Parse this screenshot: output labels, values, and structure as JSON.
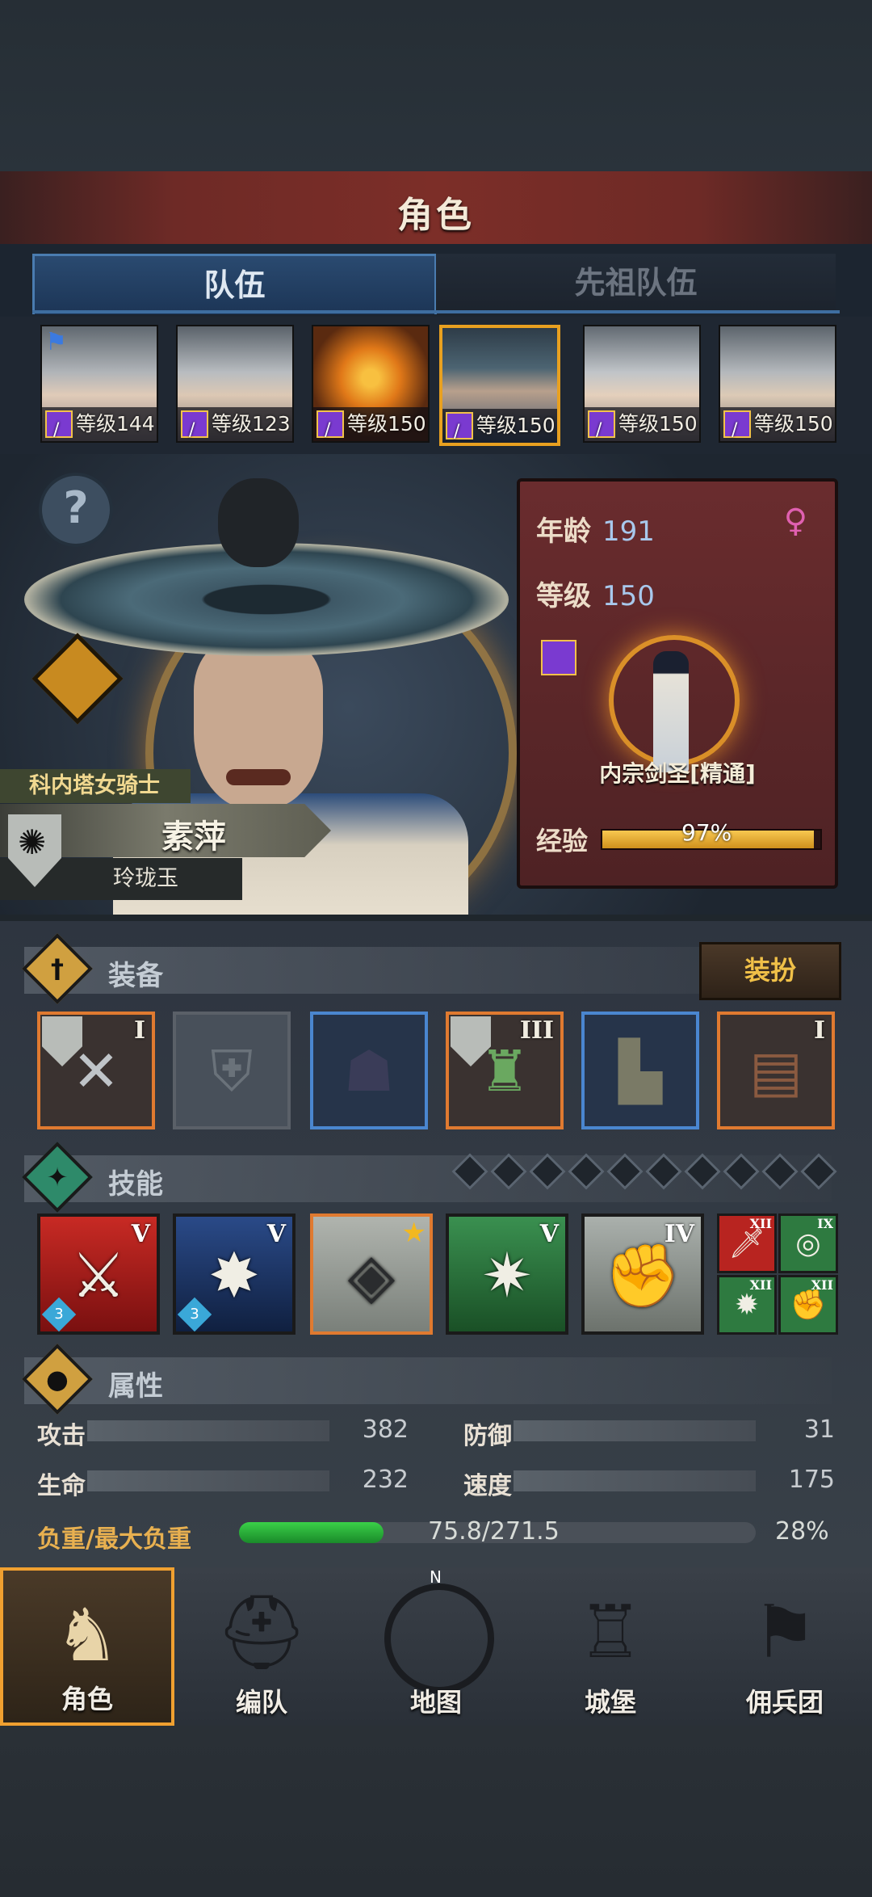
{
  "header": {
    "title": "角色"
  },
  "tabs": [
    {
      "label": "队伍",
      "active": true
    },
    {
      "label": "先祖队伍",
      "active": false
    }
  ],
  "roster": [
    {
      "level_text": "等级144",
      "portrait": "elf-woman-portrait",
      "flag": true
    },
    {
      "level_text": "等级123",
      "portrait": "elf-woman-portrait"
    },
    {
      "level_text": "等级150",
      "portrait": "pumpkin-portrait"
    },
    {
      "level_text": "等级150",
      "portrait": "straw-hat-swordsman-portrait",
      "selected": true
    },
    {
      "level_text": "等级150",
      "portrait": "elf-woman-portrait"
    },
    {
      "level_text": "等级150",
      "portrait": "elf-woman-portrait"
    }
  ],
  "character": {
    "faction": "科内塔女骑士",
    "name": "素萍",
    "title": "玲珑玉",
    "age_label": "年龄",
    "age": "191",
    "gender_icon": "female-icon",
    "level_label": "等级",
    "level": "150",
    "class_name": "内宗剑圣[精通]",
    "exp_label": "经验",
    "exp_text": "97%",
    "exp_fraction": 0.97
  },
  "equipment": {
    "section_title": "装备",
    "outfit_button": "装扮",
    "slots": [
      {
        "item": "crossed-blades-icon",
        "rank": "I",
        "rarity": "orange",
        "badge": true
      },
      {
        "item": "empty-shield-slot-icon",
        "rank": "",
        "rarity": "empty"
      },
      {
        "item": "hood-icon",
        "rank": "",
        "rarity": "blue"
      },
      {
        "item": "green-armor-icon",
        "rank": "III",
        "rarity": "orange",
        "badge": true
      },
      {
        "item": "boots-icon",
        "rank": "",
        "rarity": "blue"
      },
      {
        "item": "tome-icon",
        "rank": "I",
        "rarity": "orange"
      }
    ]
  },
  "skills": {
    "section_title": "技能",
    "pip_count": 10,
    "items": [
      {
        "icon": "broken-sword-icon",
        "rank": "V",
        "gem": "3",
        "color": "red"
      },
      {
        "icon": "summon-burst-icon",
        "rank": "V",
        "gem": "3",
        "color": "navy"
      },
      {
        "icon": "crystal-sword-icon",
        "rank": "",
        "star": true,
        "color": "grey"
      },
      {
        "icon": "crystal-blast-icon",
        "rank": "V",
        "color": "green"
      },
      {
        "icon": "crystal-fist-icon",
        "rank": "IV",
        "color": "greyb"
      }
    ],
    "mini": [
      {
        "icon": "sword-icon",
        "rank": "XII",
        "color": "#b82420"
      },
      {
        "icon": "target-icon",
        "rank": "IX",
        "color": "#2e7a40"
      },
      {
        "icon": "burst-icon",
        "rank": "XII",
        "color": "#2e7a40"
      },
      {
        "icon": "fist-icon",
        "rank": "XII",
        "color": "#2e7a40"
      }
    ]
  },
  "attributes": {
    "section_title": "属性",
    "attack_label": "攻击",
    "attack": "382",
    "defense_label": "防御",
    "defense": "31",
    "hp_label": "生命",
    "hp": "232",
    "speed_label": "速度",
    "speed": "175",
    "weight_label": "负重/最大负重",
    "weight_text": "75.8/271.5",
    "weight_pct": "28%",
    "weight_fraction": 0.28
  },
  "nav": [
    {
      "label": "角色",
      "icon": "knight-icon",
      "active": true
    },
    {
      "label": "编队",
      "icon": "helmet-icon"
    },
    {
      "label": "地图",
      "icon": "compass-icon"
    },
    {
      "label": "城堡",
      "icon": "castle-icon"
    },
    {
      "label": "佣兵团",
      "icon": "banner-fist-icon"
    }
  ],
  "colors": {
    "accent": "#e8a020",
    "title_bar": "#7c2e28",
    "tab_active": "#2a4a70",
    "exp": "#f0b030",
    "weight": "#2ab83a"
  }
}
